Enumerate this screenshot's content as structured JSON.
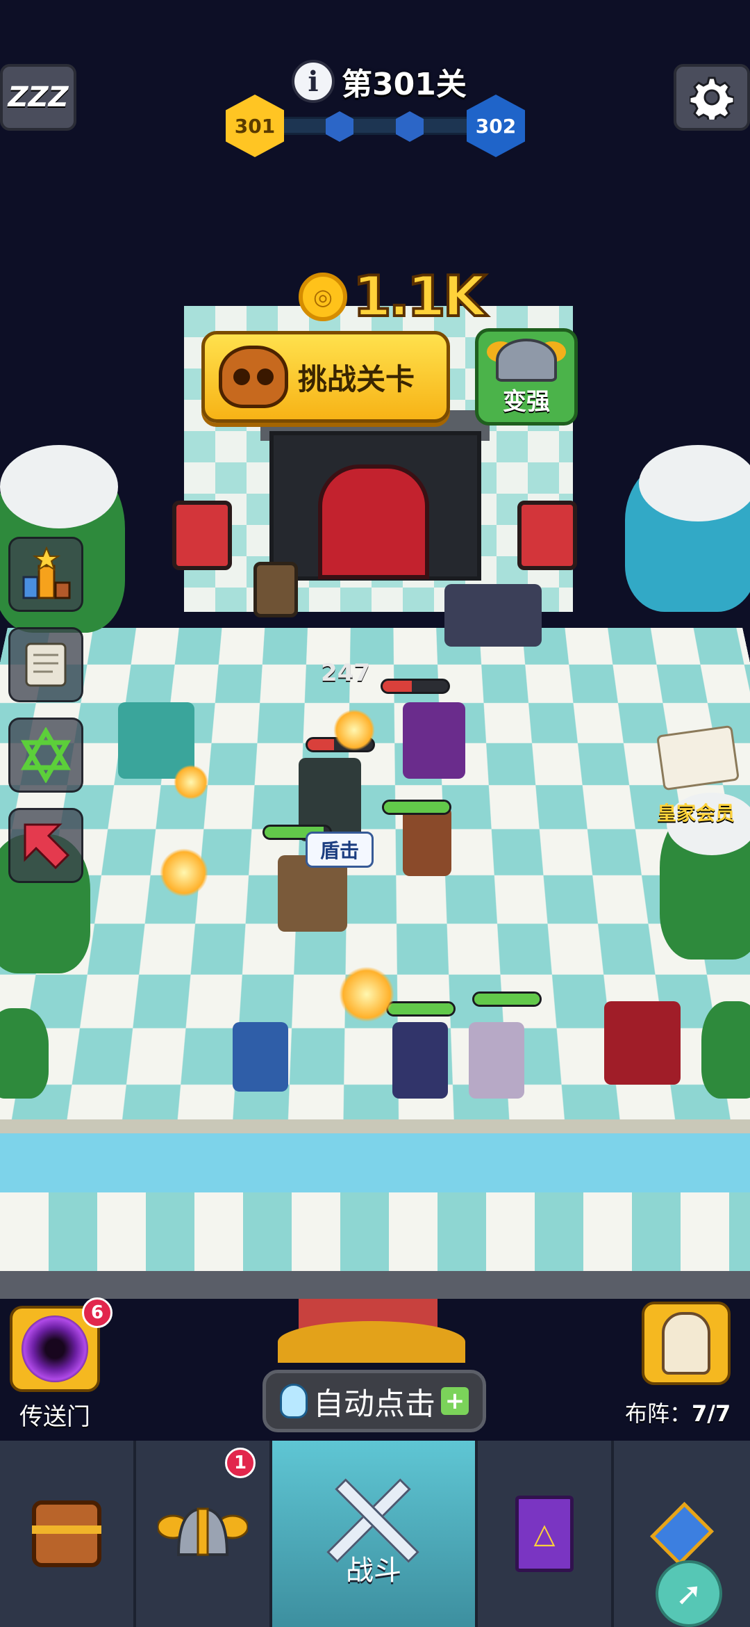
{
  "header": {
    "info_icon": "i",
    "level_title": "第301关",
    "current_level": "301",
    "next_level": "302"
  },
  "hud": {
    "sleep_icon": "ZZZ",
    "settings_icon": "gear",
    "coins": "1.1K"
  },
  "actions": {
    "challenge_label": "挑战关卡",
    "power_up_label": "变强"
  },
  "side_menu": {
    "items": [
      "ranking-icon",
      "scroll-icon",
      "star-of-david-icon",
      "red-arrow-icon"
    ]
  },
  "vip": {
    "label": "皇家会员"
  },
  "battle": {
    "damage_number": "247",
    "skill_tag": "盾击"
  },
  "portal": {
    "label": "传送门",
    "badge": "6"
  },
  "auto_click": {
    "label": "自动点击",
    "plus_icon": "+"
  },
  "formation": {
    "label_prefix": "布阵：",
    "value": "7/7"
  },
  "nav": {
    "items": [
      {
        "icon": "treasure-chest-icon",
        "label": ""
      },
      {
        "icon": "winged-helmet-icon",
        "label": "",
        "badge": "1"
      },
      {
        "icon": "crossed-swords-icon",
        "label": "战斗"
      },
      {
        "icon": "spellbook-icon",
        "label": ""
      },
      {
        "icon": "amulet-icon",
        "label": ""
      }
    ]
  },
  "rocket_icon": "rocket"
}
